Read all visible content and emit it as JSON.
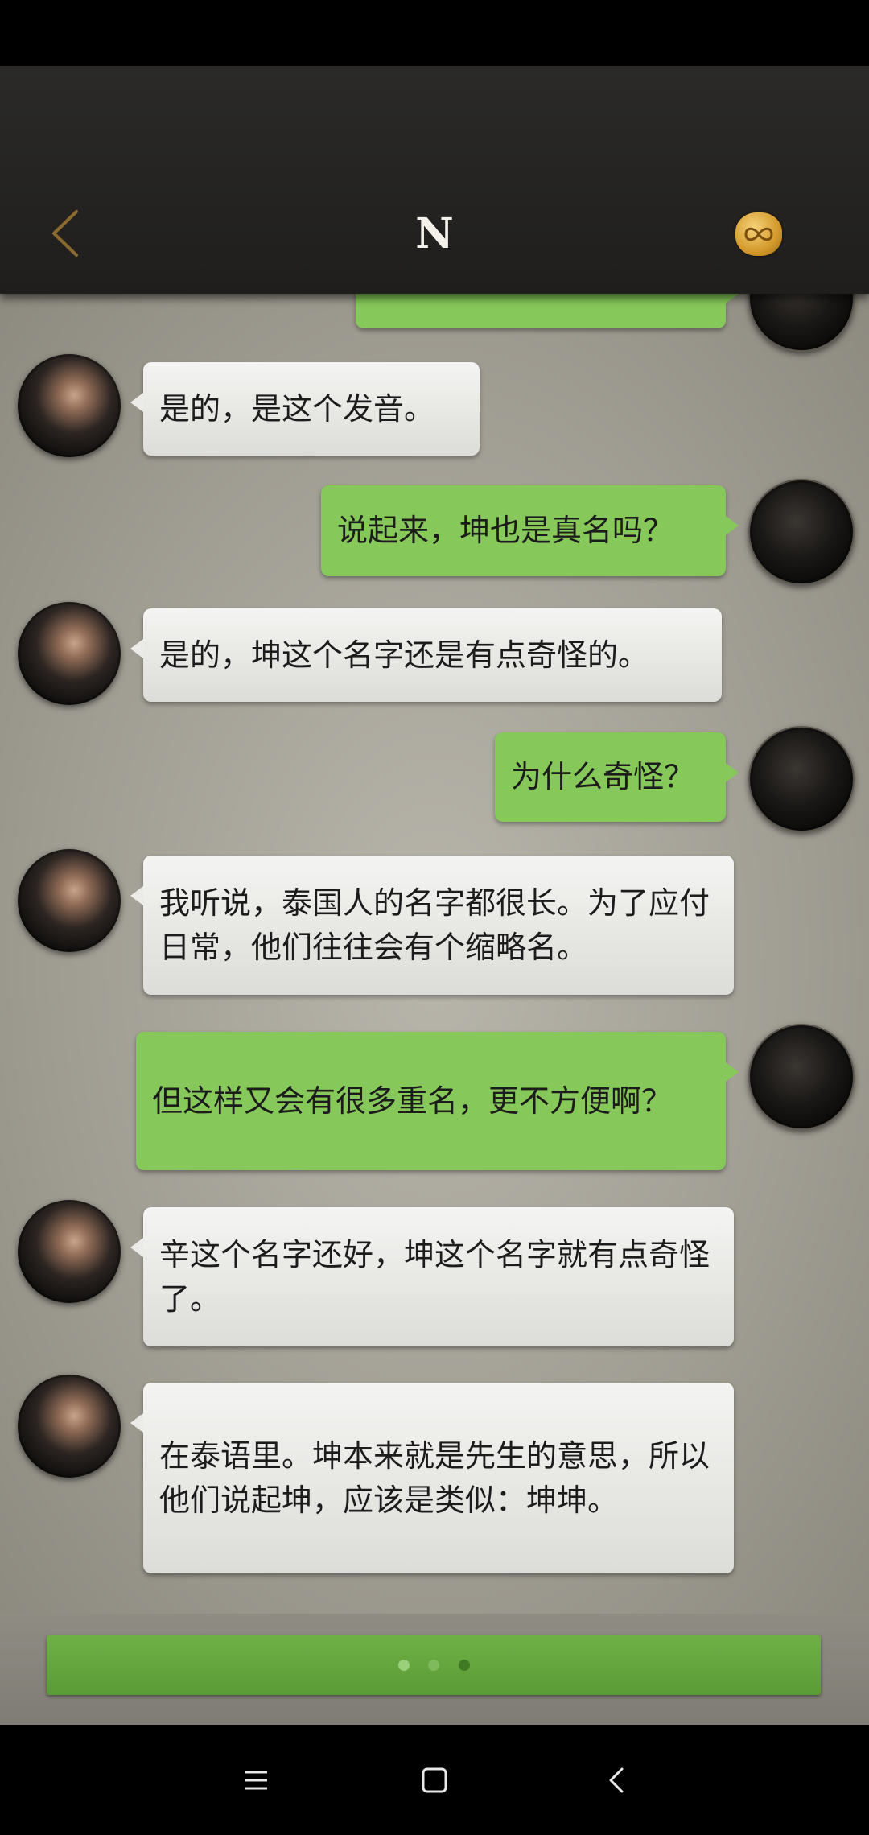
{
  "header": {
    "title": "N",
    "back_icon": "chevron-left-icon",
    "action_icon": "infinity-badge-icon"
  },
  "messages": [
    {
      "sender": "other",
      "text": "是的，是这个发音。"
    },
    {
      "sender": "self",
      "text": "说起来，坤也是真名吗？"
    },
    {
      "sender": "other",
      "text": "是的，坤这个名字还是有点奇怪的。"
    },
    {
      "sender": "self",
      "text": "为什么奇怪？"
    },
    {
      "sender": "other",
      "text": "我听说，泰国人的名字都很长。为了应付日常，他们往往会有个缩略名。"
    },
    {
      "sender": "self",
      "text": "但这样又会有很多重名，更不方便啊？"
    },
    {
      "sender": "other",
      "text": "辛这个名字还好，坤这个名字就有点奇怪了。"
    },
    {
      "sender": "other",
      "text": "在泰语里。坤本来就是先生的意思，所以他们说起坤，应该是类似：坤坤。"
    }
  ],
  "pager": {
    "count": 3,
    "active_index": 2
  },
  "colors": {
    "self_bubble": "#86c85a",
    "other_bubble": "#ecebe8",
    "continue_bar": "#67a840"
  },
  "nav": {
    "menu_icon": "menu-icon",
    "home_icon": "home-square-icon",
    "back_icon": "back-arrow-icon"
  }
}
